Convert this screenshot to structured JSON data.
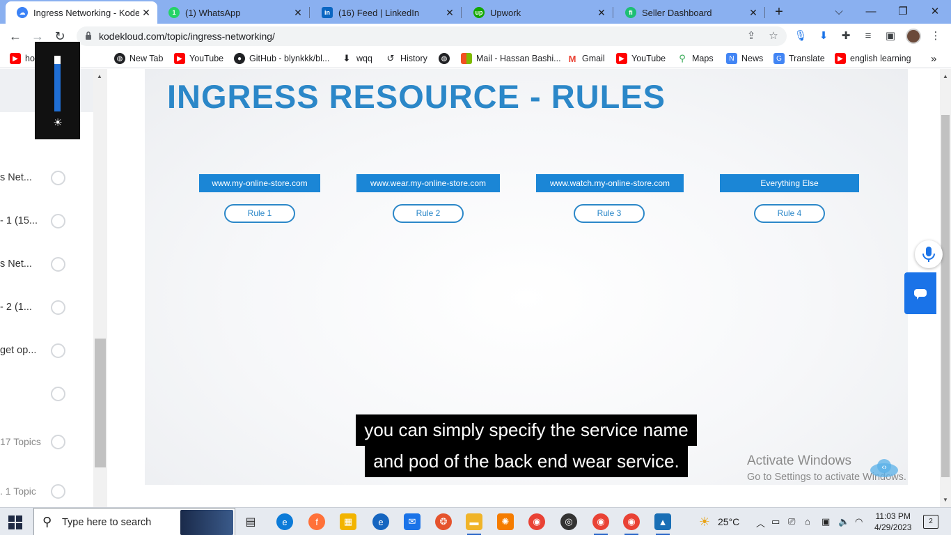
{
  "browser": {
    "tabs": [
      {
        "title": "Ingress Networking - KodeKl",
        "active": true,
        "icon": "kodekloud-icon",
        "color": "#3b82f6"
      },
      {
        "title": "(1) WhatsApp",
        "active": false,
        "icon": "whatsapp-icon",
        "color": "#25d366"
      },
      {
        "title": "(16) Feed | LinkedIn",
        "active": false,
        "icon": "linkedin-icon",
        "color": "#0a66c2"
      },
      {
        "title": "Upwork",
        "active": false,
        "icon": "upwork-icon",
        "color": "#14a800"
      },
      {
        "title": "Seller Dashboard",
        "active": false,
        "icon": "fiverr-icon",
        "color": "#1dbf73"
      }
    ],
    "close_glyph": "✕",
    "new_tab_glyph": "+",
    "window_controls": {
      "dropdown": "⌵",
      "minimize": "—",
      "restore": "❐",
      "close": "✕"
    },
    "url": "kodekloud.com/topic/ingress-networking/",
    "bookmarks": [
      {
        "label": "ho...   e urdu i...",
        "icon": "youtube-icon",
        "color": "#ff0000"
      },
      {
        "label": "New Tab",
        "icon": "globe-icon",
        "color": "#202124"
      },
      {
        "label": "YouTube",
        "icon": "youtube-icon",
        "color": "#ff0000"
      },
      {
        "label": "GitHub - blynkkk/bl...",
        "icon": "github-icon",
        "color": "#202124"
      },
      {
        "label": "wqq",
        "icon": "download-icon",
        "color": "#202124"
      },
      {
        "label": "History",
        "icon": "history-icon",
        "color": "#202124"
      },
      {
        "label": "",
        "icon": "globe-icon",
        "color": "#202124"
      },
      {
        "label": "Mail - Hassan Bashi...",
        "icon": "microsoft-icon",
        "color": "#f25022"
      },
      {
        "label": "Gmail",
        "icon": "gmail-icon",
        "color": "#ea4335"
      },
      {
        "label": "YouTube",
        "icon": "youtube-icon",
        "color": "#ff0000"
      },
      {
        "label": "Maps",
        "icon": "maps-icon",
        "color": "#34a853"
      },
      {
        "label": "News",
        "icon": "news-icon",
        "color": "#4285f4"
      },
      {
        "label": "Translate",
        "icon": "translate-icon",
        "color": "#4285f4"
      },
      {
        "label": "english learning",
        "icon": "youtube-icon",
        "color": "#ff0000"
      }
    ],
    "bookmarks_more": "»"
  },
  "sidebar": {
    "lessons": [
      {
        "text": "s Net...",
        "muted": false
      },
      {
        "text": "- 1 (15...",
        "muted": false
      },
      {
        "text": "s Net...",
        "muted": false
      },
      {
        "text": "- 2 (1...",
        "muted": false
      },
      {
        "text": "get op...",
        "muted": false
      },
      {
        "text": "",
        "muted": false
      },
      {
        "text": "17 Topics",
        "muted": true
      },
      {
        "text": ".  1 Topic",
        "muted": true
      }
    ]
  },
  "video": {
    "title": "INGRESS RESOURCE - RULES",
    "hosts": [
      "www.my-online-store.com",
      "www.wear.my-online-store.com",
      "www.watch.my-online-store.com",
      "Everything Else"
    ],
    "rules": [
      "Rule 1",
      "Rule 2",
      "Rule 3",
      "Rule 4"
    ],
    "caption_lines": [
      "you can simply specify the service name",
      "and pod of the back end wear service."
    ]
  },
  "watermark": {
    "line1": "Activate Windows",
    "line2": "Go to Settings to activate Windows."
  },
  "taskbar": {
    "search_placeholder": "Type here to search",
    "temperature": "25°C",
    "time": "11:03 PM",
    "date": "4/29/2023",
    "notifications": "2"
  },
  "colors": {
    "accent_blue": "#2b87c8",
    "host_blue": "#1b86d6",
    "tab_strip": "#8ab0f0"
  }
}
